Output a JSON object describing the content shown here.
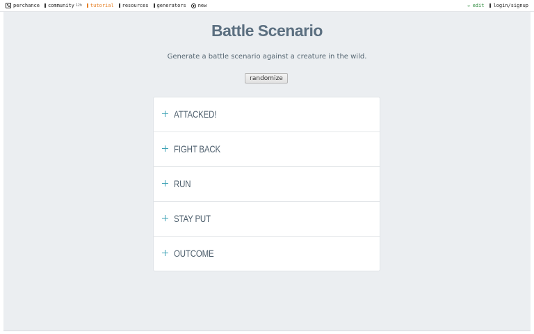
{
  "topbar": {
    "left": [
      {
        "label": "perchance",
        "icon": "dice-icon"
      },
      {
        "label": "community",
        "badge": "12h",
        "icon": "bar-icon"
      },
      {
        "label": "tutorial",
        "icon": "bar-icon",
        "color": "#e67e22"
      },
      {
        "label": "resources",
        "icon": "bar-icon"
      },
      {
        "label": "generators",
        "icon": "bar-icon"
      },
      {
        "label": "new",
        "icon": "plus-circle-icon"
      }
    ],
    "right": [
      {
        "label": "edit",
        "icon": "pencil-icon",
        "color": "#2e8b3e"
      },
      {
        "label": "login/signup",
        "icon": "bar-icon"
      }
    ]
  },
  "page": {
    "title": "Battle Scenario",
    "subtitle": "Generate a battle scenario against a creature in the wild.",
    "randomize_label": "randomize"
  },
  "sections": [
    "ATTACKED!",
    "FIGHT BACK",
    "RUN",
    "STAY PUT",
    "OUTCOME"
  ],
  "colors": {
    "accent": "#3aa0b4",
    "title": "#5b6f80",
    "background": "#ebeef1"
  }
}
